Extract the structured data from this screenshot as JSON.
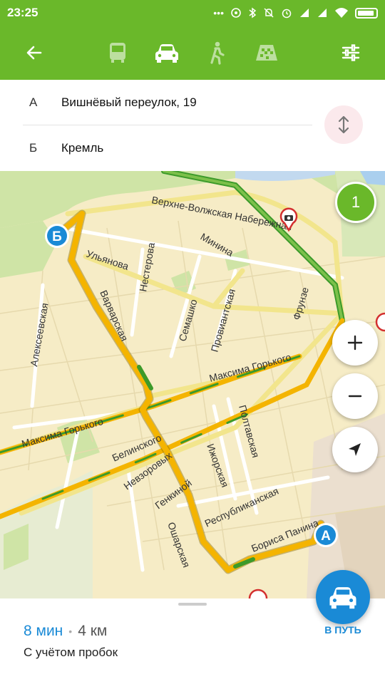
{
  "status_bar": {
    "time": "23:25",
    "icons": [
      "dots-icon",
      "hotspot-icon",
      "bluetooth-icon",
      "mute-icon",
      "alarm-icon",
      "signal-icon",
      "signal-icon",
      "wifi-icon",
      "battery-icon"
    ]
  },
  "toolbar": {
    "modes": [
      "bus-icon",
      "car-icon",
      "walk-icon",
      "taxi-icon"
    ],
    "active_mode": "car-icon"
  },
  "route": {
    "from_letter": "А",
    "from": "Вишнёвый переулок, 19",
    "to_letter": "Б",
    "to": "Кремль"
  },
  "map": {
    "streets": {
      "verkhne": "Верхне-Волжская Набережная",
      "ulyanova": "Ульянова",
      "nesterova": "Нестерова",
      "minina": "Минина",
      "varvarskaya": "Варварская",
      "alekseevskaya": "Алексеевская",
      "semashko": "Семашко",
      "proviantskaya": "Провиантская",
      "frunze": "Фрунзе",
      "gorkogo1": "Максима Горького",
      "gorkogo2": "Максима Горького",
      "belinskogo": "Белинского",
      "poltavskaya": "Полтавская",
      "nevzorovykh": "Невзоровых",
      "izhorskaya": "Ижорская",
      "genkinoy": "Генкиной",
      "respublikanskaya": "Республиканская",
      "osharskaya": "Ошарская",
      "borisa": "Бориса Панина"
    },
    "marker_a": "А",
    "marker_b": "Б",
    "cluster_count": "1"
  },
  "summary": {
    "time": "8 мин",
    "separator": "•",
    "distance": "4 км",
    "note": "С учётом пробок",
    "go_label": "В ПУТЬ"
  },
  "colors": {
    "accent": "#6ab82a",
    "primary": "#1a8ad6",
    "route": "#f4b400"
  }
}
